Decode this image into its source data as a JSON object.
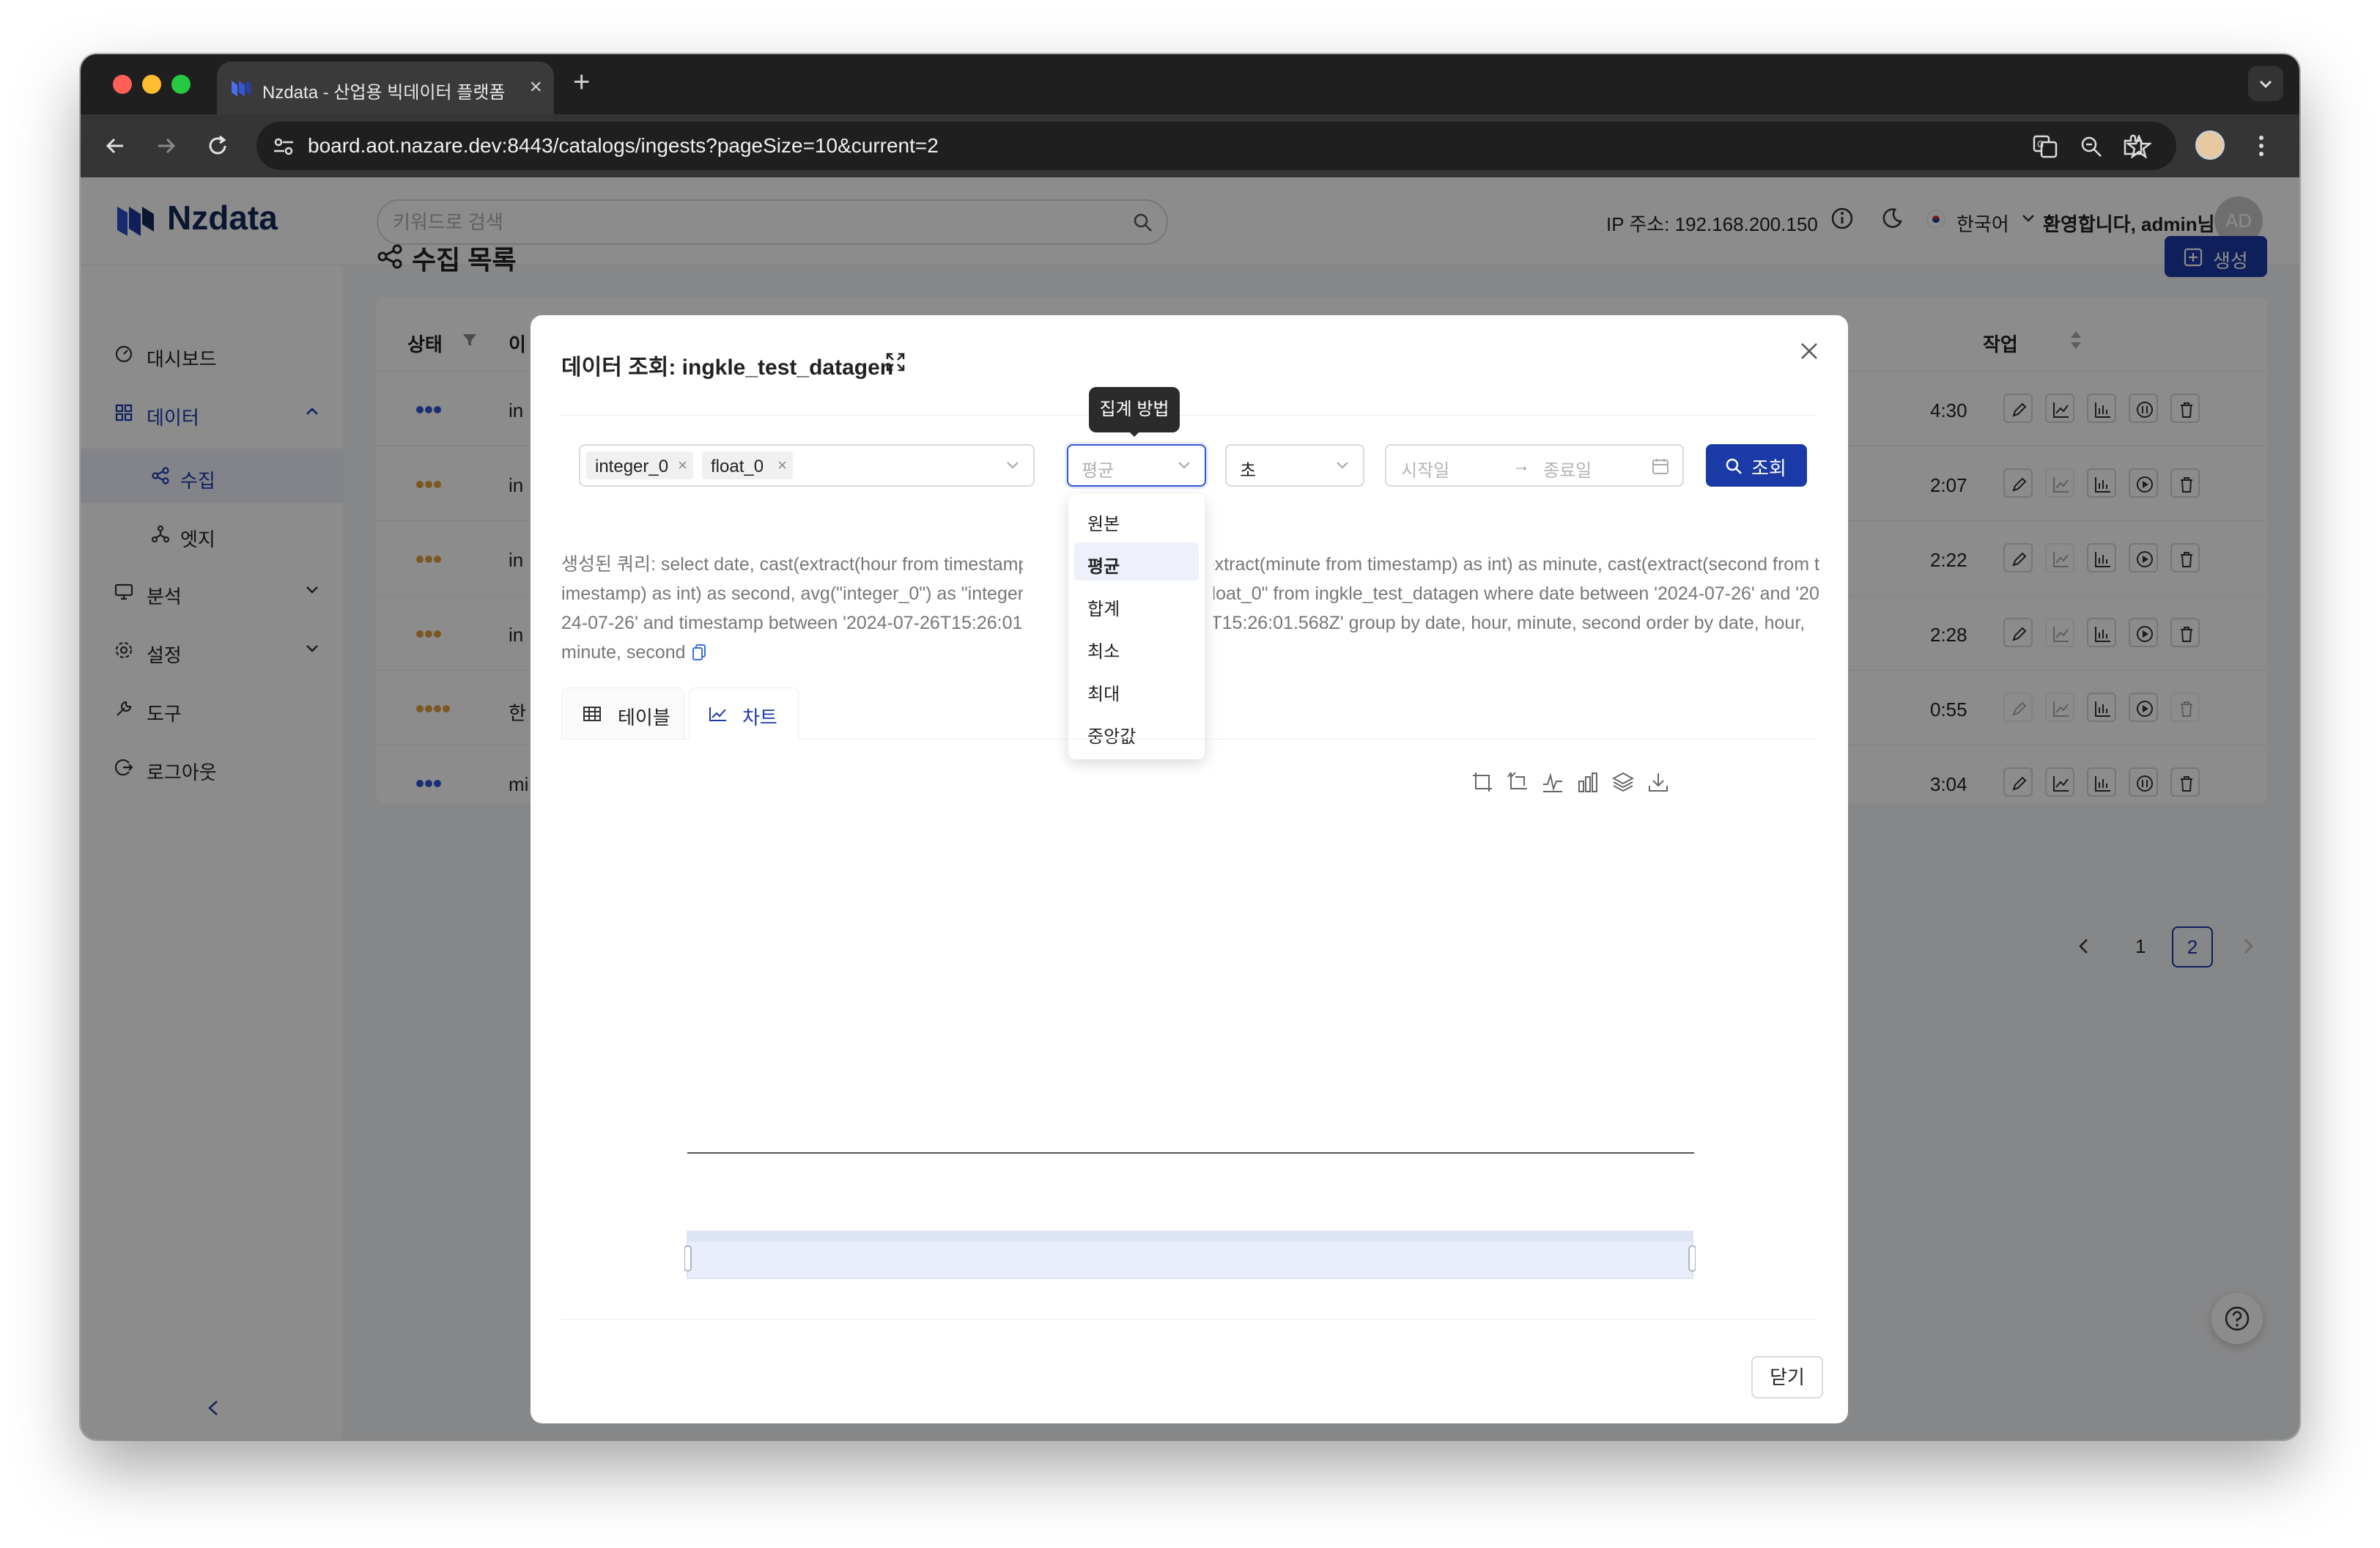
{
  "browser": {
    "tab_title": "Nzdata - 산업용 빅데이터 플랫폼",
    "url": "board.aot.nazare.dev:8443/catalogs/ingests?pageSize=10&current=2"
  },
  "header": {
    "logo": "Nzdata",
    "search_placeholder": "키워드로 검색",
    "ip_label": "IP 주소: 192.168.200.150",
    "language": "한국어",
    "welcome": "환영합니다, admin님",
    "avatar": "AD"
  },
  "sidebar": {
    "items": [
      {
        "label": "대시보드"
      },
      {
        "label": "데이터"
      },
      {
        "label": "수집"
      },
      {
        "label": "엣지"
      },
      {
        "label": "분석"
      },
      {
        "label": "설정"
      },
      {
        "label": "도구"
      },
      {
        "label": "로그아웃"
      }
    ]
  },
  "page": {
    "title": "수집 목록",
    "create_label": "생성",
    "columns": {
      "status": "상태",
      "name": "이",
      "action": "작업"
    },
    "rows": [
      {
        "name": "in",
        "time": "4:30"
      },
      {
        "name": "in",
        "time": "2:07"
      },
      {
        "name": "in",
        "time": "2:22"
      },
      {
        "name": "in",
        "time": "2:28"
      },
      {
        "name": "한",
        "time": "0:55"
      },
      {
        "name": "mi",
        "time": "3:04"
      }
    ],
    "pagination": {
      "page1": "1",
      "page2": "2"
    }
  },
  "modal": {
    "title": "데이터 조회: ingkle_test_datagen",
    "columns_chips": [
      "integer_0",
      "float_0"
    ],
    "aggregation": {
      "tooltip": "집계 방법",
      "value": "평균",
      "options": [
        "원본",
        "평균",
        "합계",
        "최소",
        "최대",
        "중앙값"
      ]
    },
    "unit_value": "초",
    "date_start_placeholder": "시작일",
    "date_arrow": "→",
    "date_end_placeholder": "종료일",
    "query_button": "조회",
    "query_text": "생성된 쿼리: select date, cast(extract(hour from timestamp) as int) as hour, cast(extract(minute from timestamp) as int) as minute, cast(extract(second from timestamp) as int) as second, avg(\"integer_0\") as \"integer_0\", avg(\"float_0\") as \"float_0\" from ingkle_test_datagen where date between '2024-07-26' and '2024-07-26' and timestamp between '2024-07-26T15:26:01.568Z' and '2024-07-26T15:26:01.568Z' group by date, hour, minute, second order by date, hour, minute, second",
    "tabs": {
      "table": "테이블",
      "chart": "차트"
    },
    "close_label": "닫기"
  },
  "colors": {
    "primary": "#1a3aa8",
    "status_blue": "#2f55d4",
    "status_orange": "#e0a040"
  }
}
